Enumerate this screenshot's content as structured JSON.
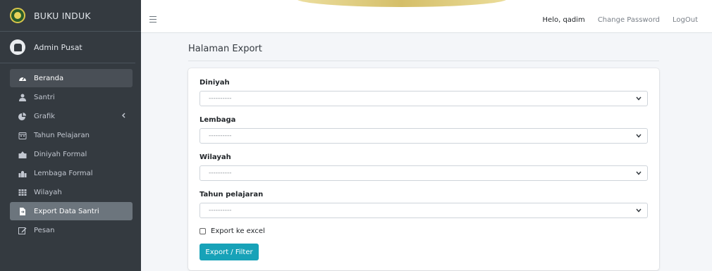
{
  "brand": {
    "title": "BUKU INDUK"
  },
  "user_panel": {
    "name": "Admin Pusat"
  },
  "sidebar": {
    "items": [
      {
        "label": "Beranda",
        "icon": "tachometer-icon"
      },
      {
        "label": "Santri",
        "icon": "user-icon"
      },
      {
        "label": "Grafik",
        "icon": "chart-pie-icon"
      },
      {
        "label": "Tahun Pelajaran",
        "icon": "calendar-icon"
      },
      {
        "label": "Diniyah Formal",
        "icon": "school-icon"
      },
      {
        "label": "Lembaga Formal",
        "icon": "building-icon"
      },
      {
        "label": "Wilayah",
        "icon": "table-grid-icon"
      },
      {
        "label": "Export Data Santri",
        "icon": "file-export-icon"
      },
      {
        "label": "Pesan",
        "icon": "edit-icon"
      }
    ]
  },
  "topbar": {
    "greeting": "Helo, qadim",
    "change_password": "Change Password",
    "logout": "LogOut"
  },
  "page": {
    "title": "Halaman Export"
  },
  "form": {
    "fields": [
      {
        "label": "Diniyah",
        "value": "----------"
      },
      {
        "label": "Lembaga",
        "value": "----------"
      },
      {
        "label": "Wilayah",
        "value": "----------"
      },
      {
        "label": "Tahun pelajaran",
        "value": "----------"
      }
    ],
    "checkbox_label": "Export ke excel",
    "submit_label": "Export / Filter"
  },
  "colors": {
    "sidebar_bg": "#343a40",
    "accent_button": "#17a2b8",
    "page_bg": "#f4f6f9"
  }
}
